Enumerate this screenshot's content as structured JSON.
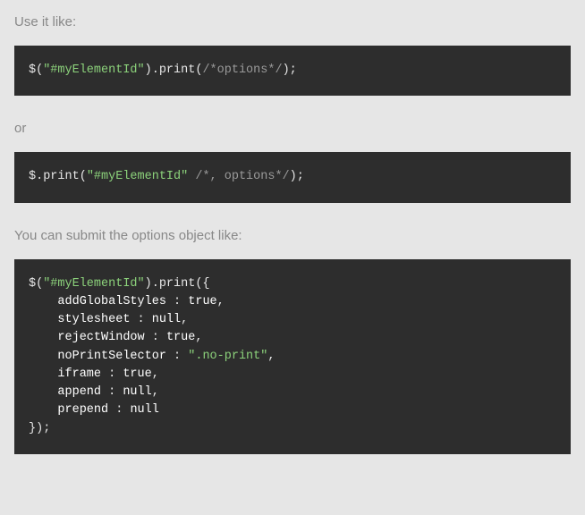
{
  "texts": {
    "intro1": "Use it like:",
    "intro2": "or",
    "intro3": "You can submit the options object like:"
  },
  "code1": {
    "pre": "$(",
    "str": "\"#myElementId\"",
    "mid": ").print(",
    "cmt": "/*options*/",
    "end": ");"
  },
  "code2": {
    "pre": "$.print(",
    "str": "\"#myElementId\"",
    "sp": " ",
    "cmt": "/*, options*/",
    "end": ");"
  },
  "code3": {
    "line0_pre": "$(",
    "line0_str": "\"#myElementId\"",
    "line0_end": ").print({",
    "l1_prop": "addGlobalStyles",
    "l1_sep": " : ",
    "l1_val": "true",
    "l1_comma": ",",
    "l2_prop": "stylesheet",
    "l2_sep": " : ",
    "l2_val": "null",
    "l2_comma": ",",
    "l3_prop": "rejectWindow",
    "l3_sep": " : ",
    "l3_val": "true",
    "l3_comma": ",",
    "l4_prop": "noPrintSelector",
    "l4_sep": " : ",
    "l4_val": "\".no-print\"",
    "l4_comma": ",",
    "l5_prop": "iframe",
    "l5_sep": " : ",
    "l5_val": "true",
    "l5_comma": ",",
    "l6_prop": "append",
    "l6_sep": " : ",
    "l6_val": "null",
    "l6_comma": ",",
    "l7_prop": "prepend",
    "l7_sep": " : ",
    "l7_val": "null",
    "line_end": "});",
    "indent": "    "
  }
}
